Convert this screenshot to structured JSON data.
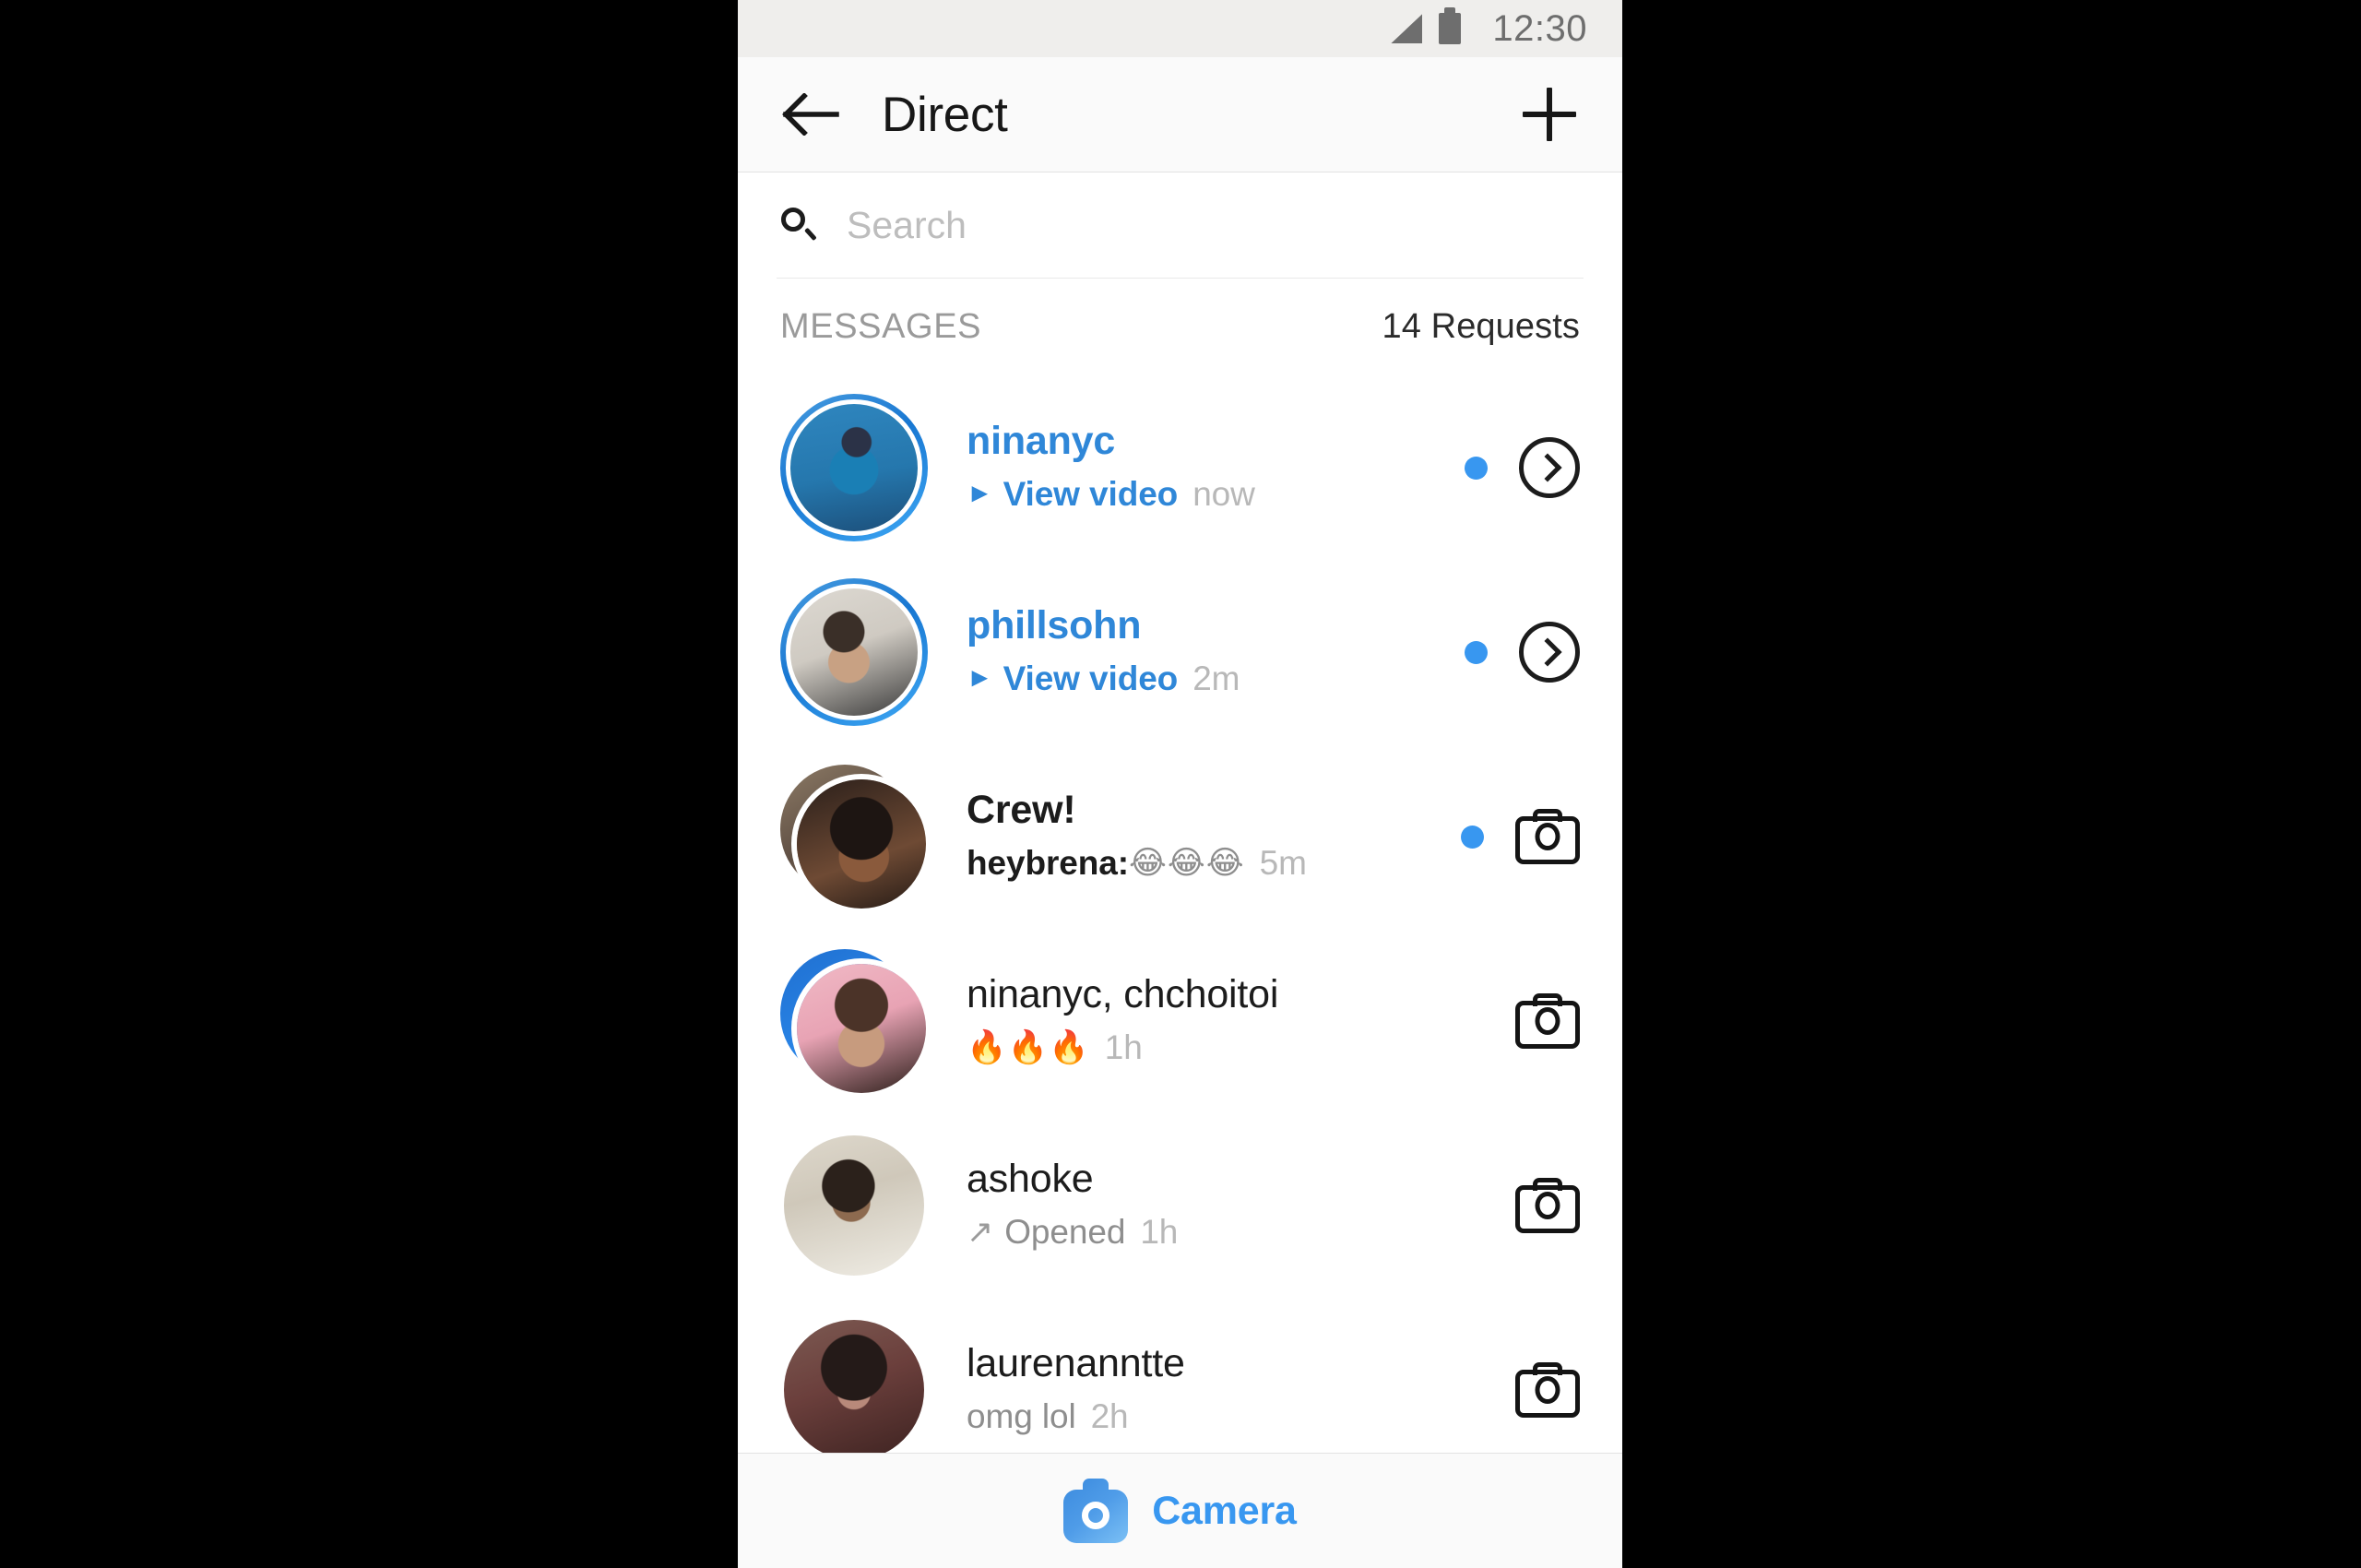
{
  "status_bar": {
    "time": "12:30",
    "signal_icon": "signal-triangle-icon",
    "battery_icon": "battery-full-icon"
  },
  "header": {
    "back_icon": "back-arrow-icon",
    "title": "Direct",
    "new_message_icon": "plus-icon"
  },
  "search": {
    "icon": "search-icon",
    "value": "",
    "placeholder": "Search"
  },
  "section": {
    "label": "MESSAGES",
    "requests_label": "14 Requests"
  },
  "colors": {
    "accent_blue": "#3897f0",
    "link_blue": "#2f87d8",
    "text_dark": "#1c1c1c",
    "text_muted": "#8e8e8e",
    "time_muted": "#b8b8b8",
    "bar_bg": "#fafafa"
  },
  "threads": [
    {
      "name": "ninanyc",
      "name_style": "blue",
      "prefix_icon": "play-triangle-icon",
      "preview": "View video",
      "preview_style": "blue",
      "time": "now",
      "unread": true,
      "action_icon": "chevron-right-circle-icon",
      "avatar": "avatar-ninanyc",
      "avatar_kind": "ring",
      "avatar_class": "pic-ninanyc"
    },
    {
      "name": "phillsohn",
      "name_style": "blue",
      "prefix_icon": "play-triangle-icon",
      "preview": "View video",
      "preview_style": "blue",
      "time": "2m",
      "unread": true,
      "action_icon": "chevron-right-circle-icon",
      "avatar": "avatar-phillsohn",
      "avatar_kind": "ring",
      "avatar_class": "pic-phillsohn"
    },
    {
      "name": "Crew!",
      "name_style": "bold",
      "prefix_icon": "",
      "preview": "heybrena:",
      "preview_style": "dark",
      "emoji": "😂😂😂",
      "time": "5m",
      "unread": true,
      "action_icon": "camera-outline-icon",
      "avatar": "avatar-crew-group",
      "avatar_kind": "stack",
      "avatar_class": "pic-crew-front",
      "avatar_class_back": "pic-crew-back"
    },
    {
      "name": "ninanyc, chchoitoi",
      "name_style": "regular",
      "prefix_icon": "",
      "preview": "",
      "preview_style": "muted",
      "emoji": "🔥🔥🔥",
      "time": "1h",
      "unread": false,
      "action_icon": "camera-outline-icon",
      "avatar": "avatar-ninanyc-chchoitoi-group",
      "avatar_kind": "stack",
      "avatar_class": "pic-nina2-front",
      "avatar_class_back": "pic-nina2-back"
    },
    {
      "name": "ashoke",
      "name_style": "regular",
      "prefix_icon": "arrow-up-right-icon",
      "preview": "Opened",
      "preview_style": "muted",
      "time": "1h",
      "unread": false,
      "action_icon": "camera-outline-icon",
      "avatar": "avatar-ashoke",
      "avatar_kind": "plain",
      "avatar_class": "pic-ashoke"
    },
    {
      "name": "laurenanntte",
      "name_style": "regular",
      "prefix_icon": "",
      "preview": "omg lol",
      "preview_style": "muted",
      "time": "2h",
      "unread": false,
      "action_icon": "camera-outline-icon",
      "avatar": "avatar-laurenanntte",
      "avatar_kind": "plain",
      "avatar_class": "pic-lauren"
    }
  ],
  "bottom_bar": {
    "icon": "camera-icon",
    "label": "Camera"
  }
}
